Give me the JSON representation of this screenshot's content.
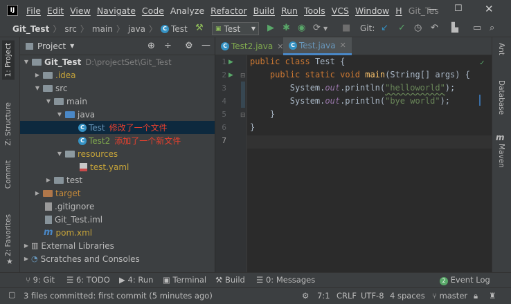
{
  "menubar": {
    "logo": "IJ",
    "menus": [
      "File",
      "Edit",
      "View",
      "Navigate",
      "Code",
      "Analyze",
      "Refactor",
      "Build",
      "Run",
      "Tools",
      "VCS",
      "Window",
      "H"
    ],
    "project_title": "Git_Tes"
  },
  "navbar": {
    "crumbs": [
      "Git_Test",
      "src",
      "main",
      "java",
      "Test"
    ],
    "run_config": "Test",
    "git_label": "Git:"
  },
  "left_strip": {
    "project_tab": "1: Project",
    "structure_tab": "Z: Structure",
    "commit_tab": "Commit",
    "favorites_tab": "2: Favorites"
  },
  "right_strip": {
    "ant_tab": "Ant",
    "database_tab": "Database",
    "maven_tab": "Maven"
  },
  "project_panel": {
    "title": "Project",
    "tree": [
      {
        "label": "Git_Test",
        "path": "D:\\projectSet\\Git_Test"
      },
      {
        "label": ".idea"
      },
      {
        "label": "src"
      },
      {
        "label": "main"
      },
      {
        "label": "java"
      },
      {
        "label": "Test",
        "note": "修改了一个文件"
      },
      {
        "label": "Test2",
        "note": "添加了一个新文件"
      },
      {
        "label": "resources"
      },
      {
        "label": "test.yaml"
      },
      {
        "label": "test"
      },
      {
        "label": "target"
      },
      {
        "label": ".gitignore"
      },
      {
        "label": "Git_Test.iml"
      },
      {
        "label": "pom.xml"
      },
      {
        "label": "External Libraries"
      },
      {
        "label": "Scratches and Consoles"
      }
    ]
  },
  "editor": {
    "tabs": [
      {
        "label": "Test2.java"
      },
      {
        "label": "Test.java"
      }
    ],
    "line_numbers": [
      "1",
      "2",
      "3",
      "4",
      "5",
      "6",
      "7"
    ],
    "code": {
      "l1_kw1": "public",
      "l1_kw2": "class",
      "l1_name": "Test",
      "l1_brace": "{",
      "l2_kw1": "public",
      "l2_kw2": "static",
      "l2_kw3": "void",
      "l2_fn": "main",
      "l2_args": "(String[] args) {",
      "l3_pre": "System.",
      "l3_out": "out",
      "l3_mid": ".println(",
      "l3_str": "\"helloworld\"",
      "l3_end": ");",
      "l4_pre": "System.",
      "l4_out": "out",
      "l4_mid": ".println(",
      "l4_str": "\"bye world\"",
      "l4_end": ");",
      "l5": "}",
      "l6": "}"
    }
  },
  "bottom_tools": {
    "git": "9: Git",
    "todo": "6: TODO",
    "run": "4: Run",
    "terminal": "Terminal",
    "build": "Build",
    "messages": "0: Messages",
    "event_log": "Event Log",
    "event_count": "2"
  },
  "statusbar": {
    "message": "3 files committed: first commit (5 minutes ago)",
    "position": "7:1",
    "line_sep": "CRLF",
    "encoding": "UTF-8",
    "indent": "4 spaces",
    "branch": "master"
  }
}
